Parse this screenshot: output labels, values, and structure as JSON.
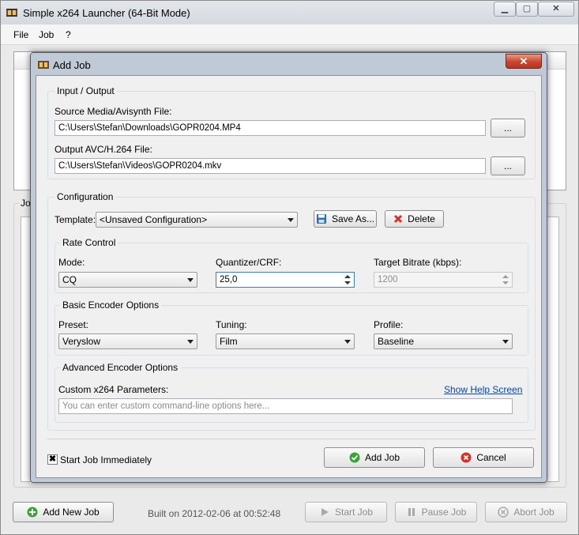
{
  "main_window": {
    "title": "Simple x264 Launcher (64-Bit Mode)",
    "menu": [
      "File",
      "Job",
      "?"
    ],
    "group_label": "Jo",
    "buttons": {
      "add_new_job": "Add New Job",
      "start_job": "Start Job",
      "pause_job": "Pause Job",
      "abort_job": "Abort Job"
    },
    "status": "Built on 2012-02-06 at 00:52:48"
  },
  "dialog": {
    "title": "Add Job",
    "io_group": {
      "legend": "Input / Output",
      "source_label": "Source Media/Avisynth File:",
      "source_value": "C:\\Users\\Stefan\\Downloads\\GOPR0204.MP4",
      "output_label": "Output AVC/H.264 File:",
      "output_value": "C:\\Users\\Stefan\\Videos\\GOPR0204.mkv",
      "browse_label": "..."
    },
    "config_group": {
      "legend": "Configuration",
      "template_label": "Template:",
      "template_value": "<Unsaved Configuration>",
      "save_as_label": "Save As...",
      "delete_label": "Delete",
      "rate_control": {
        "legend": "Rate Control",
        "mode_label": "Mode:",
        "mode_value": "CQ",
        "quantizer_label": "Quantizer/CRF:",
        "quantizer_value": "25,0",
        "bitrate_label": "Target Bitrate (kbps):",
        "bitrate_value": "1200"
      },
      "basic": {
        "legend": "Basic Encoder Options",
        "preset_label": "Preset:",
        "preset_value": "Veryslow",
        "tuning_label": "Tuning:",
        "tuning_value": "Film",
        "profile_label": "Profile:",
        "profile_value": "Baseline"
      },
      "advanced": {
        "legend": "Advanced Encoder Options",
        "custom_label": "Custom x264 Parameters:",
        "help_link": "Show Help Screen",
        "custom_placeholder": "You can enter custom command-line options here..."
      }
    },
    "start_immediately_label": "Start Job Immediately",
    "start_immediately_checked": true,
    "add_job_label": "Add Job",
    "cancel_label": "Cancel"
  },
  "colors": {
    "ok_green": "#3aa335",
    "cancel_red": "#d8312a",
    "link_blue": "#0645ad",
    "save_blue": "#2f6db3"
  }
}
